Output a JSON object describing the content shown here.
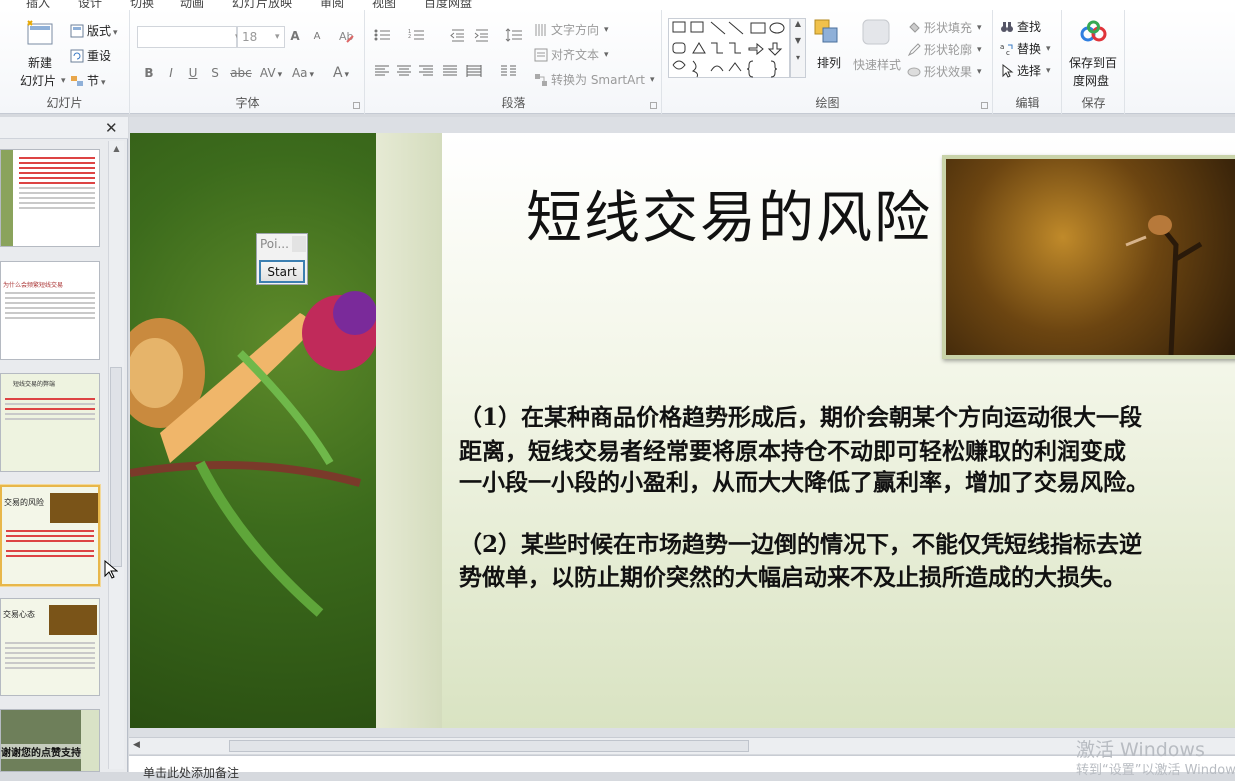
{
  "menu": {
    "tabs": [
      "插入",
      "设计",
      "切换",
      "动画",
      "幻灯片放映",
      "审阅",
      "视图",
      "百度网盘"
    ]
  },
  "ribbon": {
    "slides_group": {
      "new_slide": "新建",
      "new_slide2": "幻灯片",
      "layout": "版式",
      "reset": "重设",
      "section": "节",
      "label": "幻灯片"
    },
    "font_group": {
      "font_size": "18",
      "label": "字体",
      "bold": "B",
      "italic": "I",
      "underline": "U",
      "shadow": "S",
      "strike": "abc",
      "spacing": "AV",
      "case": "Aa",
      "color": "A",
      "grow": "A",
      "shrink": "A"
    },
    "paragraph_group": {
      "text_direction": "文字方向",
      "align_text": "对齐文本",
      "smartart": "转换为 SmartArt",
      "label": "段落"
    },
    "drawing_group": {
      "arrange": "排列",
      "quick_styles": "快速样式",
      "shape_fill": "形状填充",
      "shape_outline": "形状轮廓",
      "shape_effects": "形状效果",
      "label": "绘图"
    },
    "editing_group": {
      "find": "查找",
      "replace": "替换",
      "select": "选择",
      "label": "编辑"
    },
    "save_group": {
      "save_baidu_1": "保存到百",
      "save_baidu_2": "度网盘",
      "label": "保存"
    }
  },
  "thumbnails": [
    {
      "title": ""
    },
    {
      "title": "为什么会频繁短线交易"
    },
    {
      "title": "短线交易的弊端"
    },
    {
      "title": "交易的风险"
    },
    {
      "title": "交易心态"
    },
    {
      "title": "谢谢您的点赞支持"
    }
  ],
  "slide": {
    "title": "短线交易的风险",
    "para1_line1": "（1）在某种商品价格趋势形成后，期价会朝某个方向运动很大一段",
    "para1_line2": "距离，短线交易者经常要将原本持仓不动即可轻松赚取的利润变成",
    "para1_line3": "一小段一小段的小盈利，从而大大降低了赢利率，增加了交易风险。",
    "para2_line1": "（2）某些时候在市场趋势一边倒的情况下，不能仅凭短线指标去逆",
    "para2_line2": "势做单，以防止期价突然的大幅启动来不及止损所造成的大损失。"
  },
  "popup": {
    "title": "Poi...",
    "button": "Start"
  },
  "notes": {
    "placeholder": "单击此处添加备注"
  },
  "watermark": {
    "line1": "激活 Windows",
    "line2": "转到“设置”以激活 Windows"
  },
  "colors": {
    "accent": "#3c7fb1",
    "selected_thumb": "#e8b74a"
  }
}
